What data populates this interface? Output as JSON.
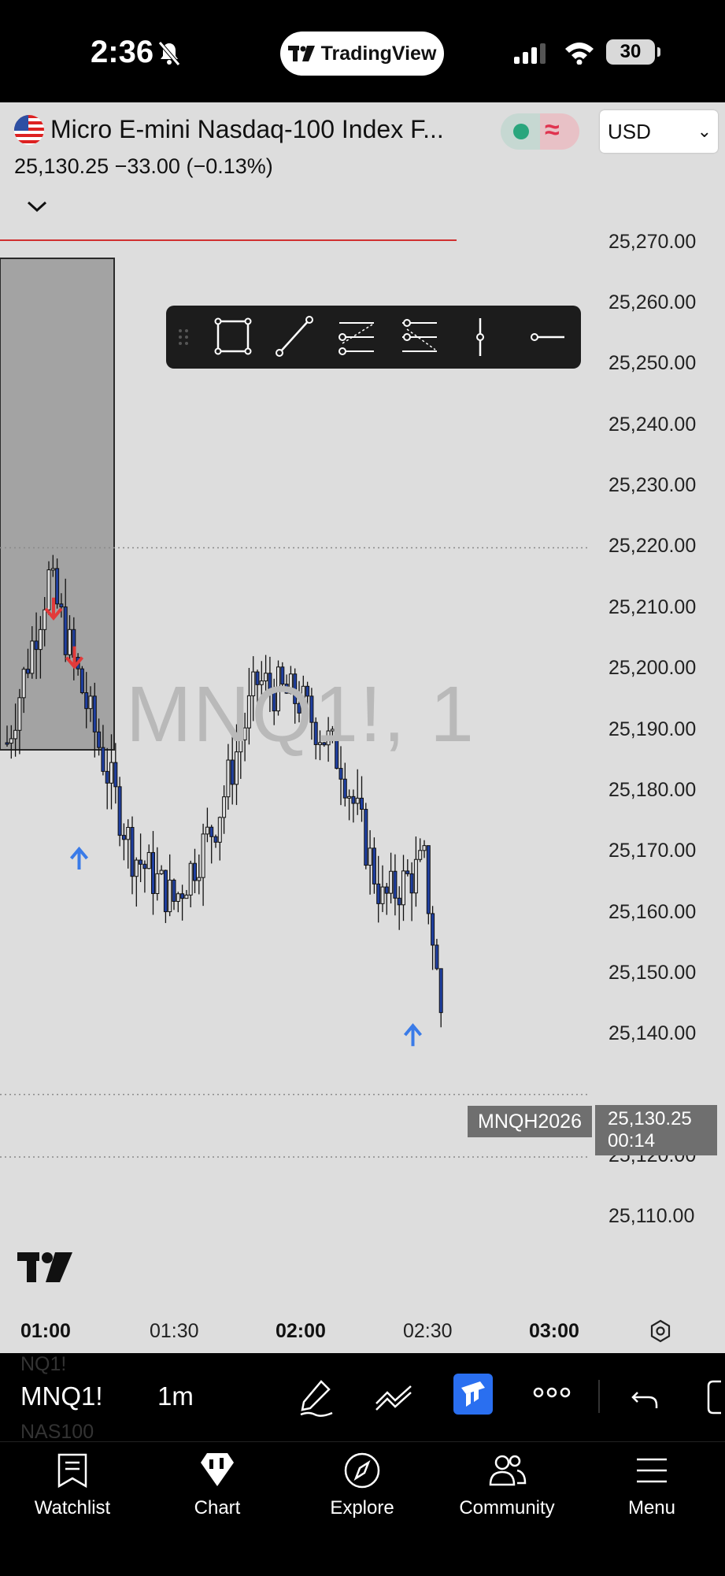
{
  "status_bar": {
    "time": "2:36",
    "app_name": "TradingView",
    "battery": "30"
  },
  "header": {
    "title": "Micro E-mini Nasdaq-100 Index F...",
    "price_line": "25,130.25  −33.00 (−0.13%)",
    "currency": "USD"
  },
  "price_axis": [
    "25,270.00",
    "25,260.00",
    "25,250.00",
    "25,240.00",
    "25,230.00",
    "25,220.00",
    "25,210.00",
    "25,200.00",
    "25,190.00",
    "25,180.00",
    "25,170.00",
    "25,160.00",
    "25,150.00",
    "25,140.00",
    "25,130.25",
    "25,120.00",
    "25,110.00"
  ],
  "last_price": {
    "label": "MNQH2026",
    "price": "25,130.25",
    "countdown": "00:14"
  },
  "watermark": "MNQ1!, 1",
  "time_axis": [
    {
      "label": "01:00",
      "bold": true
    },
    {
      "label": "01:30",
      "bold": false
    },
    {
      "label": "02:00",
      "bold": true
    },
    {
      "label": "02:30",
      "bold": false
    },
    {
      "label": "03:00",
      "bold": true
    }
  ],
  "chart_data": {
    "type": "candlestick",
    "x": [
      "00:50",
      "01:00",
      "01:10",
      "01:20",
      "01:30",
      "01:40",
      "01:50",
      "02:00",
      "02:10",
      "02:20",
      "02:30",
      "02:35"
    ],
    "close": [
      25188,
      25215,
      25192,
      25170,
      25162,
      25175,
      25198,
      25195,
      25185,
      25162,
      25168,
      25138
    ],
    "high": [
      25195,
      25222,
      25205,
      25178,
      25172,
      25195,
      25203,
      25200,
      25190,
      25175,
      25172,
      25145
    ],
    "low": [
      25180,
      25160,
      25170,
      25160,
      25158,
      25162,
      25185,
      25178,
      25158,
      25152,
      25132,
      25120
    ],
    "ylim": [
      25105,
      25275
    ],
    "signals": [
      {
        "x": "01:00",
        "direction": "down",
        "price": 25210
      },
      {
        "x": "01:05",
        "direction": "down",
        "price": 25202
      },
      {
        "x": "01:05",
        "direction": "up",
        "price": 25169
      },
      {
        "x": "02:25",
        "direction": "up",
        "price": 25140
      }
    ],
    "horizontal_levels": [
      25220,
      25130.25,
      25120
    ],
    "grid": false
  },
  "toolbar": {
    "symbol": "MNQ1!",
    "interval": "1m",
    "ghost_prev": "NQ1!",
    "ghost_next": "NAS100"
  },
  "nav": [
    {
      "label": "Watchlist",
      "icon": "watchlist-icon"
    },
    {
      "label": "Chart",
      "icon": "chart-icon"
    },
    {
      "label": "Explore",
      "icon": "explore-icon"
    },
    {
      "label": "Community",
      "icon": "community-icon"
    },
    {
      "label": "Menu",
      "icon": "menu-icon"
    }
  ]
}
